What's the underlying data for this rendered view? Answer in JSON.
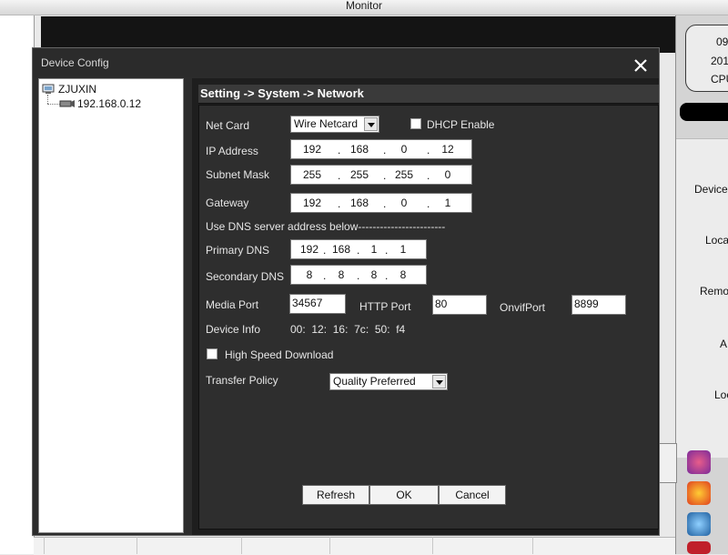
{
  "app": {
    "title": "Monitor"
  },
  "right_panel": {
    "clock_line1": "09",
    "clock_line2": "201",
    "cpu_label": "CPU",
    "labels": [
      "Device",
      "Loca",
      "Remo",
      "A",
      "Loc"
    ]
  },
  "dialog": {
    "title": "Device Config",
    "tree": {
      "root": "ZJUXIN",
      "child": "192.168.0.12"
    },
    "breadcrumb": "Setting -> System -> Network",
    "net_card": {
      "label": "Net Card",
      "value": "Wire Netcard"
    },
    "dhcp": {
      "label": "DHCP Enable",
      "checked": false
    },
    "ip_address": {
      "label": "IP Address",
      "octets": [
        "192",
        "168",
        "0",
        "12"
      ]
    },
    "subnet_mask": {
      "label": "Subnet Mask",
      "octets": [
        "255",
        "255",
        "255",
        "0"
      ]
    },
    "gateway": {
      "label": "Gateway",
      "octets": [
        "192",
        "168",
        "0",
        "1"
      ]
    },
    "dns_section": "Use DNS server address below------------------------",
    "primary_dns": {
      "label": "Primary DNS",
      "octets": [
        "192",
        "168",
        "1",
        "1"
      ]
    },
    "secondary_dns": {
      "label": "Secondary DNS",
      "octets": [
        "8",
        "8",
        "8",
        "8"
      ]
    },
    "media_port": {
      "label": "Media Port",
      "value": "34567"
    },
    "http_port": {
      "label": "HTTP Port",
      "value": "80"
    },
    "onvif_port": {
      "label": "OnvifPort",
      "value": "8899"
    },
    "device_info": {
      "label": "Device Info",
      "mac": [
        "00",
        "12",
        "16",
        "7c",
        "50",
        "f4"
      ]
    },
    "high_speed": {
      "label": "High Speed Download",
      "checked": false
    },
    "transfer_policy": {
      "label": "Transfer Policy",
      "value": "Quality Preferred"
    },
    "buttons": {
      "refresh": "Refresh",
      "ok": "OK",
      "cancel": "Cancel"
    }
  }
}
